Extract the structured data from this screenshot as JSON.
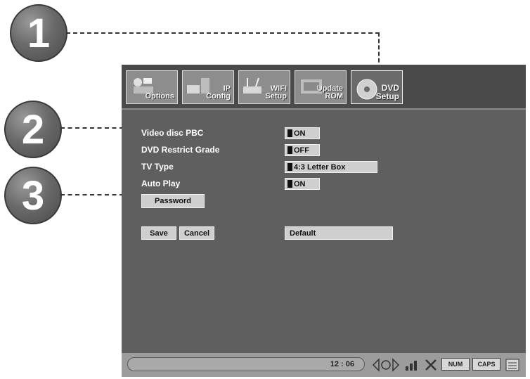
{
  "callouts": [
    "1",
    "2",
    "3"
  ],
  "tabs": [
    {
      "label": "Options",
      "icon": "options-icon",
      "active": false
    },
    {
      "label": "IP\nConfig",
      "icon": "network-config-icon",
      "active": false
    },
    {
      "label": "WIFI\nSetup",
      "icon": "wifi-router-icon",
      "active": false
    },
    {
      "label": "Update\nROM",
      "icon": "update-rom-icon",
      "active": false
    },
    {
      "label": "DVD\nSetup",
      "icon": "dvd-disc-icon",
      "active": true
    }
  ],
  "settings": [
    {
      "label": "Video disc PBC",
      "value": "ON"
    },
    {
      "label": "DVD Restrict Grade",
      "value": "OFF"
    },
    {
      "label": "TV Type",
      "value": "4:3 Letter Box"
    },
    {
      "label": "Auto Play",
      "value": "ON"
    }
  ],
  "buttons": {
    "password": "Password",
    "save": "Save",
    "cancel": "Cancel",
    "default": "Default"
  },
  "status": {
    "time": "12 : 06",
    "badge1": "NUM",
    "badge2": "CAPS"
  }
}
